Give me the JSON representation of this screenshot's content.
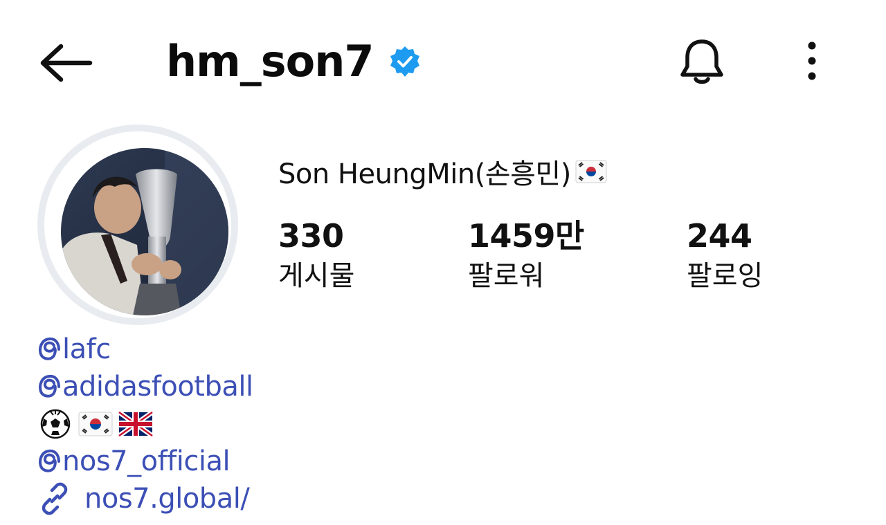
{
  "header": {
    "username": "hm_son7",
    "verified": true,
    "icons": {
      "back": "arrow-left-icon",
      "verified": "verified-badge-icon",
      "notifications": "bell-icon",
      "more": "more-vertical-icon"
    }
  },
  "profile": {
    "full_name": "Son HeungMin(손흥민)",
    "name_emoji": "south-korea-flag",
    "stats": {
      "posts": {
        "value": "330",
        "label": "게시물"
      },
      "followers": {
        "value": "1459만",
        "label": "팔로워"
      },
      "following": {
        "value": "244",
        "label": "팔로잉"
      }
    }
  },
  "bio": {
    "mention_1": "lafc",
    "mention_2": "adidasfootball",
    "emojis": [
      "soccer-ball",
      "south-korea-flag",
      "uk-flag"
    ],
    "mention_3": "nos7_official",
    "link": "nos7.global/"
  },
  "colors": {
    "text": "#111111",
    "link": "#3c4fb5",
    "verified": "#1d9bf0",
    "avatar_ring": "#e8ecf0"
  }
}
